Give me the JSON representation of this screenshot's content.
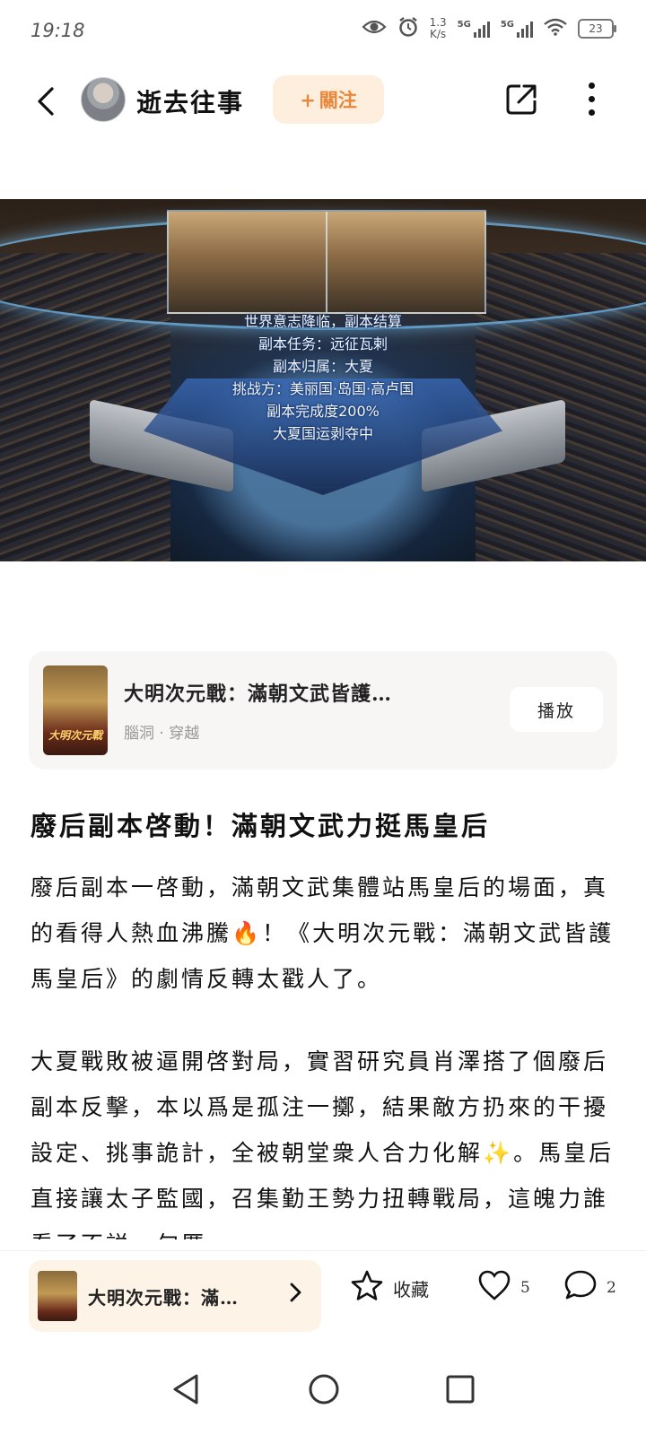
{
  "status_bar": {
    "time": "19:18",
    "speed_value": "1.3",
    "speed_unit": "K/s",
    "signal1_label": "5G",
    "signal2_label": "5G",
    "battery": "23"
  },
  "header": {
    "author": "逝去往事",
    "follow_label": "關注",
    "follow_plus": "+"
  },
  "banner": {
    "lines": [
      "世界意志降临，副本结算",
      "副本任务：远征瓦剌",
      "副本归属：大夏",
      "挑战方：美丽国·岛国·高卢国",
      "副本完成度200%",
      "大夏国运剥夺中"
    ]
  },
  "book_card": {
    "title": "大明次元戰：滿朝文武皆護…",
    "subtitle": "腦洞 · 穿越",
    "play_label": "播放",
    "cover_text": "大明次元戰"
  },
  "article": {
    "headline": "廢后副本啓動！滿朝文武力挺馬皇后",
    "paragraph1": "廢后副本一啓動，滿朝文武集體站馬皇后的場面，真的看得人熱血沸騰🔥！《大明次元戰：滿朝文武皆護馬皇后》的劇情反轉太戳人了。",
    "paragraph2": "大夏戰敗被逼開啓對局，實習研究員肖澤搭了個廢后副本反擊，本以爲是孤注一擲，結果敵方扔來的干擾設定、挑事詭計，全被朝堂衆人合力化解✨。馬皇后直接讓太子監國，召集勤王勢力扭轉戰局，這魄力誰看了不説一句厲"
  },
  "bottom_bar": {
    "mini_title": "大明次元戰：滿…",
    "favorite_label": "收藏",
    "like_count": "5",
    "comment_count": "2"
  }
}
